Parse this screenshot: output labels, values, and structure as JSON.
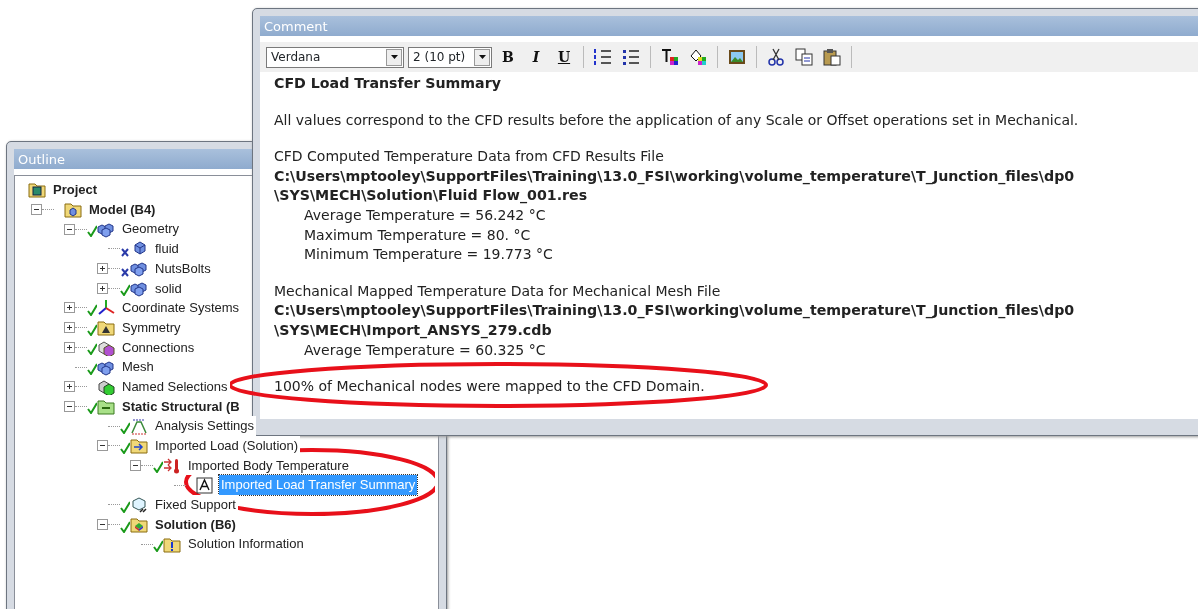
{
  "outline": {
    "title": "Outline",
    "tree": [
      {
        "label": "Project",
        "kind": "project",
        "bold": true,
        "done": false,
        "excluded": false,
        "selected": false,
        "children": [
          {
            "label": "Model (B4)",
            "kind": "model",
            "bold": true,
            "done": false,
            "excluded": false,
            "expanded": true,
            "selected": false,
            "children": [
              {
                "label": "Geometry",
                "kind": "geometry",
                "bold": false,
                "done": true,
                "excluded": false,
                "expanded": true,
                "selected": false,
                "children": [
                  {
                    "label": "fluid",
                    "kind": "body",
                    "bold": false,
                    "excluded": true,
                    "selected": false
                  },
                  {
                    "label": "NutsBolts",
                    "kind": "geometry",
                    "bold": false,
                    "excluded": true,
                    "expanded": false,
                    "selected": false
                  },
                  {
                    "label": "solid",
                    "kind": "geometry",
                    "bold": false,
                    "done": true,
                    "excluded": false,
                    "expanded": false,
                    "selected": false
                  }
                ]
              },
              {
                "label": "Coordinate Systems",
                "kind": "coordinates",
                "bold": false,
                "done": true,
                "excluded": false,
                "expanded": false,
                "selected": false
              },
              {
                "label": "Symmetry",
                "kind": "symmetry",
                "bold": false,
                "done": true,
                "excluded": false,
                "expanded": false,
                "selected": false
              },
              {
                "label": "Connections",
                "kind": "connections",
                "bold": false,
                "done": true,
                "excluded": false,
                "expanded": false,
                "selected": false
              },
              {
                "label": "Mesh",
                "kind": "mesh",
                "bold": false,
                "done": true,
                "excluded": false,
                "selected": false
              },
              {
                "label": "Named Selections",
                "kind": "selections",
                "bold": false,
                "done": false,
                "excluded": false,
                "expanded": false,
                "selected": false
              },
              {
                "label": "Static Structural (B",
                "kind": "analysis",
                "bold": true,
                "done": true,
                "excluded": false,
                "expanded": true,
                "selected": false,
                "children": [
                  {
                    "label": "Analysis Settings",
                    "kind": "settings",
                    "bold": false,
                    "done": true,
                    "excluded": false,
                    "selected": false
                  },
                  {
                    "label": "Imported Load (Solution)",
                    "kind": "load",
                    "bold": false,
                    "done": true,
                    "excluded": false,
                    "expanded": true,
                    "selected": false,
                    "children": [
                      {
                        "label": "Imported Body Temperature",
                        "kind": "temperature",
                        "bold": false,
                        "done": true,
                        "excluded": false,
                        "expanded": true,
                        "selected": false,
                        "children": [
                          {
                            "label": "Imported Load Transfer Summary",
                            "kind": "text",
                            "bold": false,
                            "done": false,
                            "excluded": false,
                            "selected": true
                          }
                        ]
                      }
                    ]
                  },
                  {
                    "label": "Fixed Support",
                    "kind": "support",
                    "bold": false,
                    "done": true,
                    "excluded": false,
                    "selected": false
                  },
                  {
                    "label": "Solution (B6)",
                    "kind": "solution",
                    "bold": true,
                    "done": true,
                    "excluded": false,
                    "expanded": true,
                    "selected": false,
                    "children": [
                      {
                        "label": "Solution Information",
                        "kind": "info",
                        "bold": false,
                        "done": true,
                        "excluded": false,
                        "selected": false
                      }
                    ]
                  }
                ]
              }
            ]
          }
        ]
      }
    ]
  },
  "comment": {
    "title": "Comment",
    "toolbar": {
      "font": "Verdana",
      "size": "2 (10 pt)",
      "format_buttons": [
        {
          "label": "B",
          "kind": "bold"
        },
        {
          "label": "I",
          "kind": "italic"
        },
        {
          "label": "U",
          "kind": "underline"
        }
      ]
    },
    "sections": [
      [
        {
          "kind": "bold",
          "text": "CFD Load Transfer Summary"
        }
      ],
      [
        {
          "kind": "plain",
          "text": "All values correspond to the CFD results before the application of any Scale or Offset operations set in Mechanical."
        }
      ],
      [
        {
          "kind": "plain",
          "text": "CFD Computed Temperature Data from CFD Results File"
        },
        {
          "kind": "bold",
          "text": "C:\\Users\\mptooley\\SupportFiles\\Training\\13.0_FSI\\working\\volume_temperature\\T_Junction_files\\dp0"
        },
        {
          "kind": "bold",
          "text": "\\SYS\\MECH\\Solution\\Fluid Flow_001.res"
        },
        {
          "kind": "indented",
          "text": "Average Temperature = 56.242  °C"
        },
        {
          "kind": "indented",
          "text": "Maximum Temperature = 80.  °C"
        },
        {
          "kind": "indented",
          "text": "Minimum Temperature = 19.773  °C"
        }
      ],
      [
        {
          "kind": "plain",
          "text": "Mechanical Mapped Temperature Data for Mechanical Mesh File"
        },
        {
          "kind": "bold",
          "text": "C:\\Users\\mptooley\\SupportFiles\\Training\\13.0_FSI\\working\\volume_temperature\\T_Junction_files\\dp0"
        },
        {
          "kind": "bold",
          "text": "\\SYS\\MECH\\Import_ANSYS_279.cdb"
        },
        {
          "kind": "indented",
          "text": "Average Temperature = 60.325  °C"
        }
      ],
      [
        {
          "kind": "plain",
          "text": "100% of Mechanical nodes were mapped to the CFD Domain."
        }
      ]
    ]
  }
}
